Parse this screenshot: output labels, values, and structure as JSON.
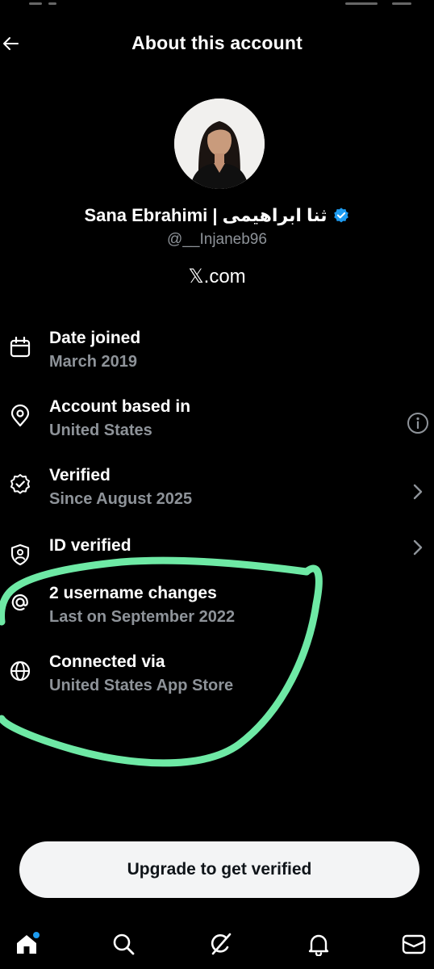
{
  "header": {
    "title": "About this account",
    "back_icon": "arrow-left-icon"
  },
  "profile": {
    "name": "Sana Ebrahimi | ثنا ابراهیمی",
    "verified_badge_color": "#1d9bf0",
    "handle": "@__Injaneb96",
    "site": "𝕏.com"
  },
  "details": [
    {
      "icon": "calendar-icon",
      "title": "Date joined",
      "value": "March 2019",
      "trailing": ""
    },
    {
      "icon": "location-pin-icon",
      "title": "Account based in",
      "value": "United States",
      "trailing": "info-icon"
    },
    {
      "icon": "verified-check-icon",
      "title": "Verified",
      "value": "Since August 2025",
      "trailing": "chevron-right-icon"
    },
    {
      "icon": "id-shield-icon",
      "title": "ID verified",
      "value": "",
      "trailing": "chevron-right-icon"
    },
    {
      "icon": "at-sign-icon",
      "title": "2 username changes",
      "value": "Last on September 2022",
      "trailing": ""
    },
    {
      "icon": "globe-icon",
      "title": "Connected via",
      "value": "United States App Store",
      "trailing": ""
    }
  ],
  "annotation_color": "#6ee9a5",
  "upgrade_button": "Upgrade to get verified",
  "bottom_nav": [
    {
      "icon": "home-icon",
      "active": true,
      "notification_dot": "#1d9bf0"
    },
    {
      "icon": "search-icon",
      "active": false
    },
    {
      "icon": "grok-icon",
      "active": false
    },
    {
      "icon": "bell-icon",
      "active": false
    },
    {
      "icon": "mail-icon",
      "active": false
    }
  ]
}
